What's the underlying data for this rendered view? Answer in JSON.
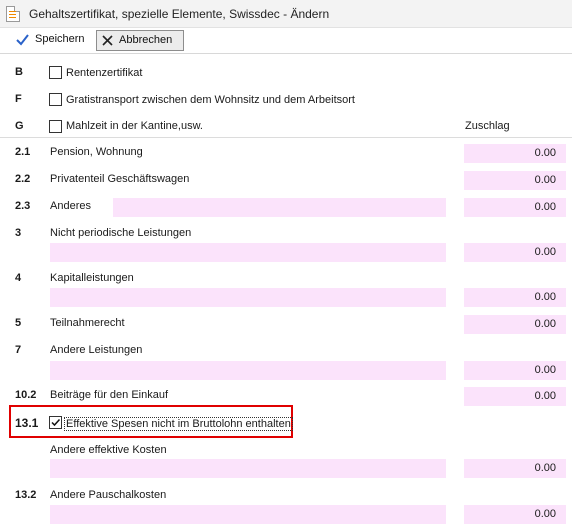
{
  "window": {
    "title": "Gehaltszertifikat, spezielle Elemente, Swissdec - Ändern"
  },
  "toolbar": {
    "save_label": "Speichern",
    "cancel_label": "Abbrechen"
  },
  "colors": {
    "field_background": "#fbe3fb",
    "highlight_border": "#e00000",
    "save_icon": "#2a62c9"
  },
  "column_header": "Zuschlag",
  "checkbox_rows": [
    {
      "code": "B",
      "label": "Rentenzertifikat",
      "checked": false
    },
    {
      "code": "F",
      "label": "Gratistransport zwischen dem Wohnsitz und dem Arbeitsort",
      "checked": false
    },
    {
      "code": "G",
      "label": "Mahlzeit in der Kantine,usw.",
      "checked": false
    }
  ],
  "items": [
    {
      "code": "2.1",
      "label": "Pension, Wohnung",
      "value": "0.00"
    },
    {
      "code": "2.2",
      "label": "Privatenteil Geschäftswagen",
      "value": "0.00"
    },
    {
      "code": "2.3",
      "label": "Anderes",
      "value": "0.00"
    },
    {
      "code": "3",
      "label": "Nicht periodische Leistungen",
      "value": "0.00"
    },
    {
      "code": "4",
      "label": "Kapitalleistungen",
      "value": "0.00"
    },
    {
      "code": "5",
      "label": "Teilnahmerecht",
      "value": "0.00"
    },
    {
      "code": "7",
      "label": "Andere Leistungen",
      "value": "0.00"
    },
    {
      "code": "10.2",
      "label": "Beiträge für den Einkauf",
      "value": "0.00"
    }
  ],
  "section_13_1": {
    "code": "13.1",
    "checkbox_label": "Effektive Spesen nicht im Bruttolohn enthalten",
    "checked": true,
    "sub_label": "Andere effektive Kosten",
    "value": "0.00"
  },
  "section_13_2": {
    "code": "13.2",
    "label": "Andere Pauschalkosten",
    "value": "0.00"
  }
}
